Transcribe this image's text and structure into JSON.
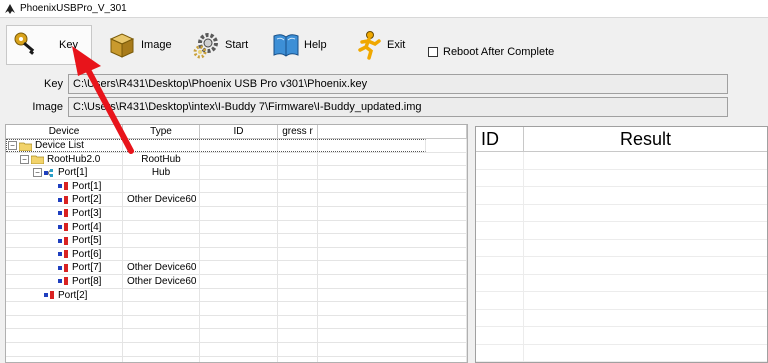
{
  "window": {
    "title": "PhoenixUSBPro_V_301"
  },
  "toolbar": {
    "key_label": "Key",
    "image_label": "Image",
    "start_label": "Start",
    "help_label": "Help",
    "exit_label": "Exit",
    "reboot_label": "Reboot After Complete",
    "reboot_checked": false
  },
  "fields": {
    "key_label": "Key",
    "key_value": "C:\\Users\\R431\\Desktop\\Phoenix USB Pro v301\\Phoenix.key",
    "image_label": "Image",
    "image_value": "C:\\Users\\R431\\Desktop\\intex\\I-Buddy 7\\Firmware\\I-Buddy_updated.img"
  },
  "device_table": {
    "columns": [
      "Device",
      "Type",
      "ID",
      "gress r",
      ""
    ],
    "rows": [
      {
        "device": "Device List",
        "type": ""
      },
      {
        "device": "RootHub2.0",
        "type": "RootHub"
      },
      {
        "device": "Port[1]",
        "type": "Hub"
      },
      {
        "device": "Port[1]",
        "type": ""
      },
      {
        "device": "Port[2]",
        "type": "Other Device60"
      },
      {
        "device": "Port[3]",
        "type": ""
      },
      {
        "device": "Port[4]",
        "type": ""
      },
      {
        "device": "Port[5]",
        "type": ""
      },
      {
        "device": "Port[6]",
        "type": ""
      },
      {
        "device": "Port[7]",
        "type": "Other Device60"
      },
      {
        "device": "Port[8]",
        "type": "Other Device60"
      },
      {
        "device": "Port[2]",
        "type": ""
      }
    ]
  },
  "result_table": {
    "id_header": "ID",
    "result_header": "Result"
  },
  "colors": {
    "annotation_arrow": "#e8141b"
  }
}
